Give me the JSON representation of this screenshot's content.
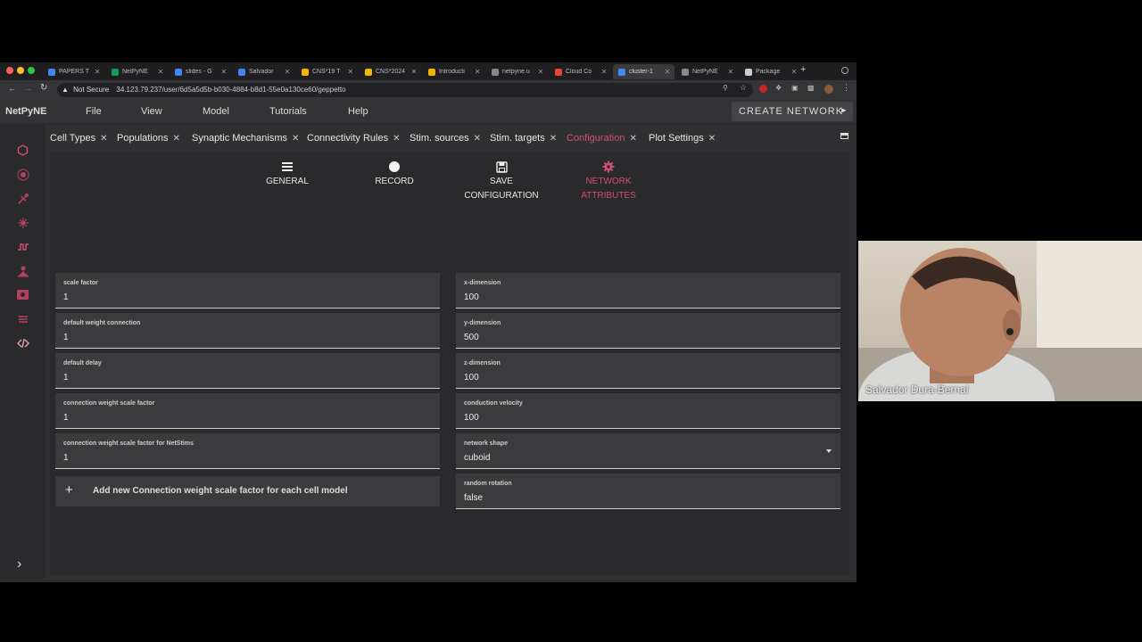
{
  "browser": {
    "tabs": [
      {
        "label": "PAPERS T",
        "color": "#4285f4"
      },
      {
        "label": "NetPyNE",
        "color": "#0f9d58"
      },
      {
        "label": "slides - G",
        "color": "#4285f4"
      },
      {
        "label": "Salvador",
        "color": "#4285f4"
      },
      {
        "label": "CNS*19 T",
        "color": "#f4b400"
      },
      {
        "label": "CNS*2024",
        "color": "#f4b400"
      },
      {
        "label": "Introducti",
        "color": "#f4b400"
      },
      {
        "label": "netpyne.u",
        "color": "#888888"
      },
      {
        "label": "Cloud Co",
        "color": "#ea4335"
      },
      {
        "label": "cluster-1",
        "color": "#4285f4"
      },
      {
        "label": "NetPyNE",
        "color": "#888888"
      },
      {
        "label": "Package",
        "color": "#cccccc"
      }
    ],
    "security_label": "Not Secure",
    "url": "34.123.79.237/user/6d5a5d5b-b030-4884-b8d1-55e0a130ce60/geppetto"
  },
  "app": {
    "brand": "NetPyNE",
    "menu": [
      "File",
      "View",
      "Model",
      "Tutorials",
      "Help"
    ],
    "create_button": "CREATE NETWORK"
  },
  "sidebar_icons": [
    "cell-types-icon",
    "populations-icon",
    "synaptic-mechanisms-icon",
    "connectivity-icon",
    "stim-sources-icon",
    "stim-targets-icon",
    "configuration-icon",
    "plot-settings-icon",
    "code-icon"
  ],
  "work_tabs": [
    {
      "label": "Cell Types"
    },
    {
      "label": "Populations"
    },
    {
      "label": "Synaptic Mechanisms"
    },
    {
      "label": "Connectivity Rules"
    },
    {
      "label": "Stim. sources"
    },
    {
      "label": "Stim. targets"
    },
    {
      "label": "Configuration",
      "active": true
    },
    {
      "label": "Plot Settings"
    }
  ],
  "actions": {
    "general": "GENERAL",
    "record": "RECORD",
    "save_1": "SAVE",
    "save_2": "CONFIGURATION",
    "network_1": "NETWORK",
    "network_2": "ATTRIBUTES"
  },
  "left_fields": [
    {
      "label": "scale factor",
      "value": "1"
    },
    {
      "label": "default weight connection",
      "value": "1"
    },
    {
      "label": "default delay",
      "value": "1"
    },
    {
      "label": "connection weight scale factor",
      "value": "1"
    },
    {
      "label": "connection weight scale factor for NetStims",
      "value": "1"
    }
  ],
  "add_row_label": "Add new Connection weight scale factor for each cell model",
  "right_fields": [
    {
      "label": "x-dimension",
      "value": "100"
    },
    {
      "label": "y-dimension",
      "value": "500"
    },
    {
      "label": "z-dimension",
      "value": "100"
    },
    {
      "label": "conduction velocity",
      "value": "100"
    },
    {
      "label": "network shape",
      "value": "cuboid"
    },
    {
      "label": "random rotation",
      "value": "false"
    }
  ],
  "colors": {
    "accent": "#d04f72"
  },
  "webcam": {
    "name": "Salvador Dura-Bernal"
  }
}
